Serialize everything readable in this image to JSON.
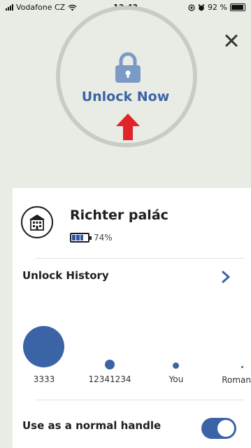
{
  "status_bar": {
    "carrier": "Vodafone CZ",
    "time": "13:43",
    "battery": "92 %"
  },
  "unlock": {
    "label": "Unlock Now",
    "colors": {
      "accent": "#3b64a6",
      "lock": "#7c9ac7",
      "arrow": "#e0242a",
      "ring": "#c8ccc8"
    }
  },
  "place": {
    "name": "Richter palác",
    "battery_percent": "74%",
    "battery_level": 0.74
  },
  "history": {
    "title": "Unlock History",
    "entries": [
      {
        "label": "3333"
      },
      {
        "label": "12341234"
      },
      {
        "label": "You"
      },
      {
        "label": "Roman"
      }
    ]
  },
  "handle": {
    "label": "Use as a normal handle",
    "enabled": true
  }
}
